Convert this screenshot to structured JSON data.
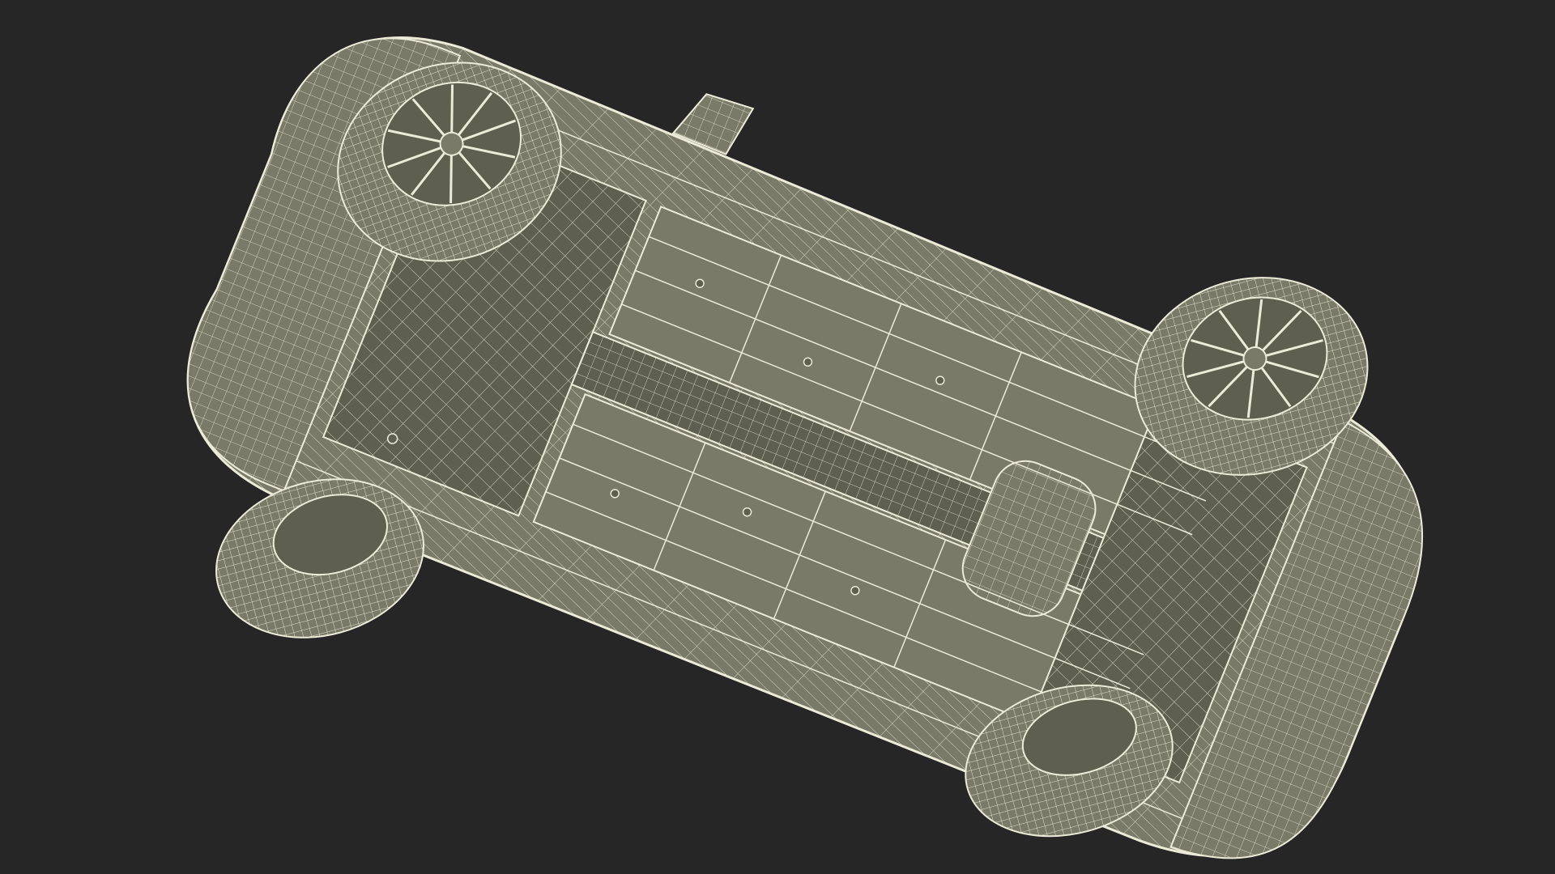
{
  "scene": {
    "background_color": "#262626",
    "mesh_fill_color": "#7a7a68",
    "mesh_fill_dark_color": "#5f5f50",
    "wire_color": "#ecebd7",
    "subject": "car-underside-wireframe"
  }
}
